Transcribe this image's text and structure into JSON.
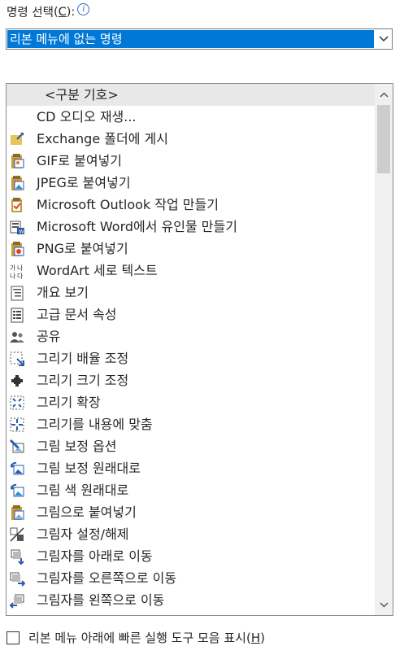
{
  "command_label": "명령 선택",
  "command_mnemonic": "C",
  "command_label_end": "):",
  "dropdown": {
    "selected": "리본 메뉴에 없는 명령"
  },
  "items": [
    {
      "label": "<구분 기호>",
      "icon": "separator"
    },
    {
      "label": "CD 오디오 재생...",
      "icon": "none"
    },
    {
      "label": "Exchange 폴더에 게시",
      "icon": "post-folder-icon"
    },
    {
      "label": "GIF로 붙여넣기",
      "icon": "paste-gif-icon"
    },
    {
      "label": "JPEG로 붙여넣기",
      "icon": "paste-jpeg-icon"
    },
    {
      "label": "Microsoft Outlook 작업 만들기",
      "icon": "outlook-task-icon"
    },
    {
      "label": "Microsoft Word에서 유인물 만들기",
      "icon": "word-handout-icon"
    },
    {
      "label": "PNG로 붙여넣기",
      "icon": "paste-png-icon"
    },
    {
      "label": "WordArt 세로 텍스트",
      "icon": "vertical-text-icon"
    },
    {
      "label": "개요 보기",
      "icon": "outline-view-icon"
    },
    {
      "label": "고급 문서 속성",
      "icon": "document-properties-icon"
    },
    {
      "label": "공유",
      "icon": "share-people-icon"
    },
    {
      "label": "그리기 배율 조정",
      "icon": "scale-drawing-icon"
    },
    {
      "label": "그리기 크기 조정",
      "icon": "resize-drawing-icon"
    },
    {
      "label": "그리기 확장",
      "icon": "expand-drawing-icon"
    },
    {
      "label": "그리기를 내용에 맞춤",
      "icon": "fit-drawing-icon"
    },
    {
      "label": "그림 보정 옵션",
      "icon": "picture-correction-icon"
    },
    {
      "label": "그림 보정 원래대로",
      "icon": "reset-picture-icon"
    },
    {
      "label": "그림 색 원래대로",
      "icon": "reset-color-icon"
    },
    {
      "label": "그림으로 붙여넣기",
      "icon": "paste-picture-icon"
    },
    {
      "label": "그림자 설정/해제",
      "icon": "shadow-toggle-icon"
    },
    {
      "label": "그림자를 아래로 이동",
      "icon": "shadow-down-icon"
    },
    {
      "label": "그림자를 오른쪽으로 이동",
      "icon": "shadow-right-icon"
    },
    {
      "label": "그림자를 왼쪽으로 이동",
      "icon": "shadow-left-icon"
    }
  ],
  "checkbox": {
    "label": "리본 메뉴 아래에 빠른 실행 도구 모음 표시(",
    "mnemonic": "H",
    "end": ")",
    "checked": false
  }
}
